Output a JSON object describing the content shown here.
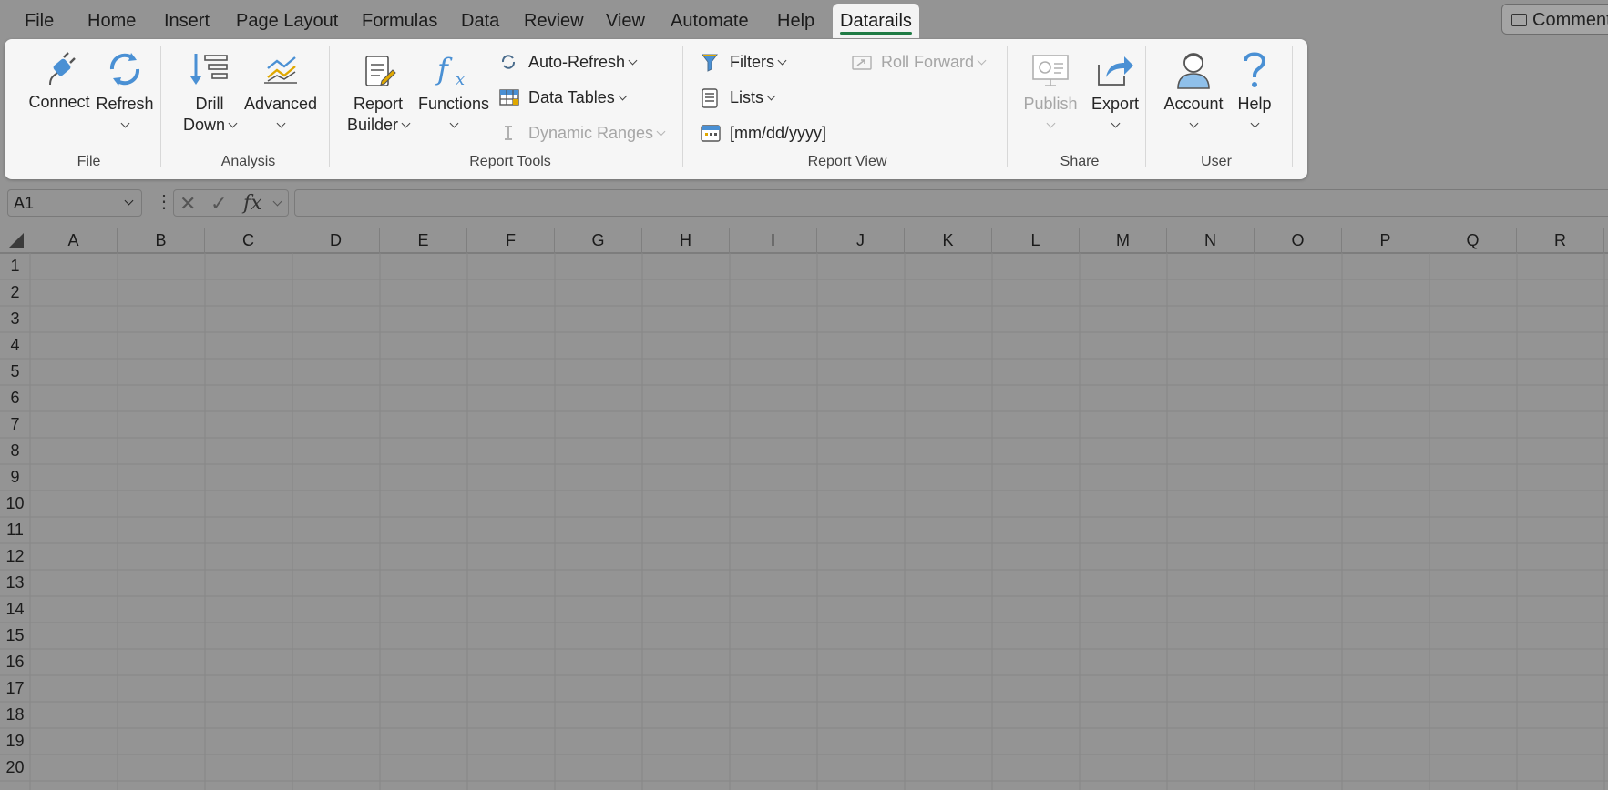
{
  "menu": {
    "tabs": [
      "File",
      "Home",
      "Insert",
      "Page Layout",
      "Formulas",
      "Data",
      "Review",
      "View",
      "Automate",
      "Help",
      "Datarails"
    ],
    "active": "Datarails",
    "comments_label": "Comments"
  },
  "ribbon": {
    "connect_label": "Connect",
    "refresh_label": "Refresh",
    "drill_label_1": "Drill",
    "drill_label_2": "Down",
    "advanced_label": "Advanced",
    "report_label_1": "Report",
    "report_label_2": "Builder",
    "functions_label": "Functions",
    "auto_refresh_label": "Auto-Refresh",
    "data_tables_label": "Data Tables",
    "dynamic_ranges_label": "Dynamic Ranges",
    "filters_label": "Filters",
    "lists_label": "Lists",
    "date_label": "[mm/dd/yyyy]",
    "roll_forward_label": "Roll Forward",
    "publish_label": "Publish",
    "export_label": "Export",
    "account_label": "Account",
    "help_label": "Help",
    "groups": {
      "file": "File",
      "analysis": "Analysis",
      "report_tools": "Report Tools",
      "report_view": "Report View",
      "share": "Share",
      "user": "User"
    }
  },
  "formula_bar": {
    "name_box": "A1",
    "fx_label": "fx",
    "formula": ""
  },
  "sheet": {
    "columns": [
      "A",
      "B",
      "C",
      "D",
      "E",
      "F",
      "G",
      "H",
      "I",
      "J",
      "K",
      "L",
      "M",
      "N",
      "O",
      "P",
      "Q",
      "R"
    ],
    "rows": [
      "1",
      "2",
      "3",
      "4",
      "5",
      "6",
      "7",
      "8",
      "9",
      "10",
      "11",
      "12",
      "13",
      "14",
      "15",
      "16",
      "17",
      "18",
      "19",
      "20"
    ]
  },
  "colors": {
    "background": "#949494",
    "ribbon": "#f6f6f6",
    "accent": "#1f7a44",
    "icon_blue": "#3b86c8"
  }
}
